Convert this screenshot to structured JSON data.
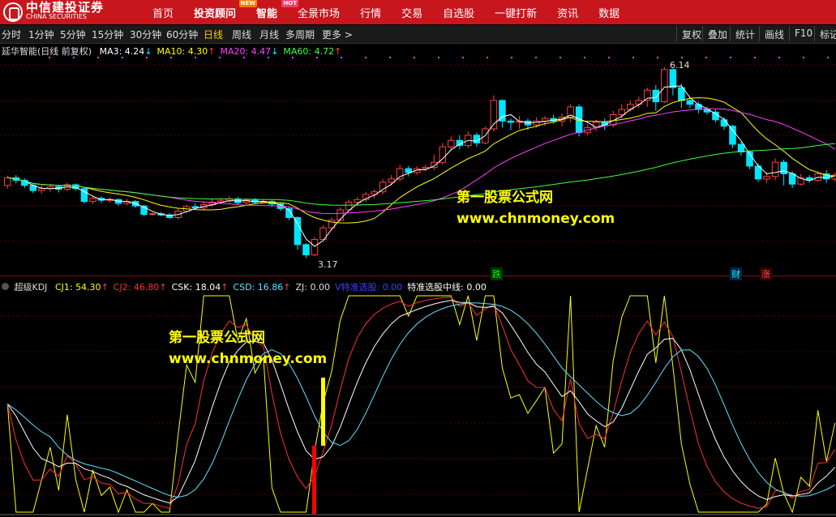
{
  "topbar": {
    "logo_cn": "中信建投证券",
    "logo_en": "CHINA SECURITIES",
    "nav": [
      {
        "label": "首页",
        "badge": ""
      },
      {
        "label": "投资顾问",
        "badge": "NEW",
        "bold": true
      },
      {
        "label": "智能",
        "badge": "HOT",
        "bold": true
      },
      {
        "label": "全景市场",
        "badge": ""
      },
      {
        "label": "行情",
        "badge": ""
      },
      {
        "label": "交易",
        "badge": ""
      },
      {
        "label": "自选股",
        "badge": ""
      },
      {
        "label": "一键打新",
        "badge": ""
      },
      {
        "label": "资讯",
        "badge": ""
      },
      {
        "label": "数据",
        "badge": ""
      }
    ]
  },
  "toolbar": {
    "periods": [
      "分时",
      "1分钟",
      "5分钟",
      "15分钟",
      "30分钟",
      "60分钟",
      "日线",
      "周线",
      "月线",
      "多周期",
      "更多 >"
    ],
    "active_period": "日线",
    "right_buttons": [
      "复权",
      "叠加",
      "统计",
      "画线",
      "F10",
      "标记"
    ]
  },
  "main_panel": {
    "title": "延华智能(日线 前复权)",
    "indicators": [
      {
        "label": "MA3: 4.24",
        "arrow": "↓",
        "color": "#ffffff"
      },
      {
        "label": "MA10: 4.30",
        "arrow": "↑",
        "color": "#ffff00"
      },
      {
        "label": "MA20: 4.47",
        "arrow": "↓",
        "color": "#ff40ff"
      },
      {
        "label": "MA60: 4.72",
        "arrow": "↑",
        "color": "#40ff40"
      }
    ],
    "high_label": "6.14",
    "low_label": "3.17",
    "markers": [
      {
        "text": "跌",
        "color": "#00ff00",
        "bg": "#003300"
      },
      {
        "text": "财",
        "color": "#00ffff",
        "bg": "#002244"
      },
      {
        "text": "涨",
        "color": "#ff5050",
        "bg": "#330000"
      }
    ],
    "watermark_title": "第一股票公式网",
    "watermark_url": "www.chnmoney.com"
  },
  "sub_panel": {
    "title": "超级KDJ",
    "indicators": [
      {
        "label": "CJ1: 54.30",
        "arrow": "↑",
        "color": "#ffff00"
      },
      {
        "label": "CJ2: 46.80",
        "arrow": "↑",
        "color": "#ff3030"
      },
      {
        "label": "CSK: 18.04",
        "arrow": "↑",
        "color": "#ffffff"
      },
      {
        "label": "CSD: 16.86",
        "arrow": "↑",
        "color": "#60e0ff"
      },
      {
        "label": "ZJ: 0.00",
        "arrow": "",
        "color": "#dddddd"
      },
      {
        "label": "V特准选股: 0.00",
        "arrow": "",
        "color": "#4040ff"
      },
      {
        "label": "特准选股中线: 0.00",
        "arrow": "",
        "color": "#ffffff"
      }
    ],
    "watermark_title": "第一股票公式网",
    "watermark_url": "www.chnmoney.com"
  },
  "colors": {
    "up": "#ff4040",
    "down": "#00e5ff",
    "topbar": "#c8161d"
  },
  "chart_data": {
    "type": "candlestick",
    "title": "延华智能(日线 前复权)",
    "ylim": [
      3.0,
      6.3
    ],
    "candles": [
      [
        4.3,
        4.42,
        4.25,
        4.45
      ],
      [
        4.42,
        4.38,
        4.33,
        4.46
      ],
      [
        4.38,
        4.3,
        4.26,
        4.41
      ],
      [
        4.3,
        4.22,
        4.18,
        4.33
      ],
      [
        4.22,
        4.25,
        4.17,
        4.3
      ],
      [
        4.25,
        4.28,
        4.2,
        4.32
      ],
      [
        4.28,
        4.24,
        4.19,
        4.31
      ],
      [
        4.24,
        4.31,
        4.21,
        4.34
      ],
      [
        4.31,
        4.25,
        4.22,
        4.33
      ],
      [
        4.25,
        4.05,
        4.02,
        4.27
      ],
      [
        4.05,
        4.1,
        4.01,
        4.14
      ],
      [
        4.1,
        4.07,
        4.03,
        4.13
      ],
      [
        4.07,
        4.08,
        4.03,
        4.11
      ],
      [
        4.08,
        4.02,
        3.98,
        4.1
      ],
      [
        4.02,
        4.05,
        3.99,
        4.09
      ],
      [
        4.05,
        3.98,
        3.95,
        4.07
      ],
      [
        3.98,
        3.85,
        3.82,
        4.0
      ],
      [
        3.85,
        3.86,
        3.83,
        3.88
      ],
      [
        3.86,
        3.84,
        3.82,
        3.89
      ],
      [
        3.84,
        3.8,
        3.78,
        3.87
      ],
      [
        3.8,
        3.9,
        3.77,
        3.95
      ],
      [
        3.9,
        3.97,
        3.88,
        4.0
      ],
      [
        3.97,
        3.95,
        3.93,
        4.02
      ],
      [
        3.95,
        4.0,
        3.92,
        4.05
      ],
      [
        4.0,
        4.04,
        3.97,
        4.09
      ],
      [
        4.04,
        4.06,
        4.01,
        4.1
      ],
      [
        4.06,
        4.09,
        4.03,
        4.13
      ],
      [
        4.09,
        4.03,
        4.0,
        4.12
      ],
      [
        4.03,
        4.07,
        4.0,
        4.1
      ],
      [
        4.07,
        4.04,
        4.01,
        4.1
      ],
      [
        4.04,
        4.05,
        4.02,
        4.08
      ],
      [
        4.05,
        4.01,
        3.97,
        4.07
      ],
      [
        4.01,
        3.94,
        3.9,
        4.03
      ],
      [
        3.94,
        3.8,
        3.76,
        3.96
      ],
      [
        3.8,
        3.38,
        3.3,
        3.82
      ],
      [
        3.38,
        3.22,
        3.17,
        3.4
      ],
      [
        3.22,
        3.46,
        3.2,
        3.5
      ],
      [
        3.46,
        3.64,
        3.44,
        3.68
      ],
      [
        3.64,
        3.76,
        3.6,
        3.8
      ],
      [
        3.76,
        3.92,
        3.74,
        3.96
      ],
      [
        3.92,
        4.04,
        3.9,
        4.08
      ],
      [
        4.04,
        4.08,
        3.98,
        4.12
      ],
      [
        4.08,
        4.16,
        4.04,
        4.2
      ],
      [
        4.16,
        4.2,
        4.1,
        4.24
      ],
      [
        4.2,
        4.35,
        4.16,
        4.4
      ],
      [
        4.35,
        4.4,
        4.3,
        4.46
      ],
      [
        4.4,
        4.56,
        4.36,
        4.62
      ],
      [
        4.56,
        4.5,
        4.44,
        4.6
      ],
      [
        4.5,
        4.56,
        4.46,
        4.6
      ],
      [
        4.56,
        4.58,
        4.52,
        4.62
      ],
      [
        4.58,
        4.66,
        4.54,
        4.78
      ],
      [
        4.66,
        4.9,
        4.62,
        4.96
      ],
      [
        4.9,
        5.0,
        4.84,
        5.06
      ],
      [
        5.0,
        4.92,
        4.86,
        5.08
      ],
      [
        4.92,
        5.08,
        4.88,
        5.14
      ],
      [
        5.08,
        4.96,
        4.9,
        5.12
      ],
      [
        4.96,
        5.18,
        4.94,
        5.22
      ],
      [
        5.18,
        5.62,
        5.14,
        5.7
      ],
      [
        5.62,
        5.3,
        5.2,
        5.64
      ],
      [
        5.3,
        5.28,
        5.16,
        5.34
      ],
      [
        5.28,
        5.3,
        5.18,
        5.38
      ],
      [
        5.3,
        5.24,
        5.16,
        5.34
      ],
      [
        5.24,
        5.3,
        5.2,
        5.36
      ],
      [
        5.3,
        5.34,
        5.22,
        5.38
      ],
      [
        5.34,
        5.3,
        5.26,
        5.4
      ],
      [
        5.3,
        5.36,
        5.22,
        5.42
      ],
      [
        5.36,
        5.52,
        5.28,
        5.56
      ],
      [
        5.52,
        5.12,
        5.06,
        5.56
      ],
      [
        5.12,
        5.2,
        5.08,
        5.26
      ],
      [
        5.2,
        5.28,
        5.14,
        5.32
      ],
      [
        5.28,
        5.24,
        5.16,
        5.34
      ],
      [
        5.24,
        5.4,
        5.2,
        5.46
      ],
      [
        5.4,
        5.48,
        5.34,
        5.56
      ],
      [
        5.48,
        5.56,
        5.44,
        5.62
      ],
      [
        5.56,
        5.62,
        5.5,
        5.68
      ],
      [
        5.62,
        5.78,
        5.52,
        5.82
      ],
      [
        5.78,
        5.6,
        5.46,
        5.86
      ],
      [
        5.6,
        6.1,
        5.58,
        6.14
      ],
      [
        6.1,
        5.82,
        5.7,
        6.12
      ],
      [
        5.82,
        5.62,
        5.5,
        5.88
      ],
      [
        5.62,
        5.56,
        5.5,
        5.66
      ],
      [
        5.56,
        5.48,
        5.42,
        5.6
      ],
      [
        5.48,
        5.44,
        5.4,
        5.52
      ],
      [
        5.44,
        5.32,
        5.28,
        5.48
      ],
      [
        5.32,
        5.22,
        5.16,
        5.36
      ],
      [
        5.22,
        4.94,
        4.88,
        5.24
      ],
      [
        4.94,
        4.82,
        4.76,
        4.98
      ],
      [
        4.82,
        4.6,
        4.55,
        4.85
      ],
      [
        4.6,
        4.4,
        4.36,
        4.64
      ],
      [
        4.4,
        4.44,
        4.34,
        4.5
      ],
      [
        4.44,
        4.66,
        4.38,
        4.72
      ],
      [
        4.66,
        4.48,
        4.3,
        4.7
      ],
      [
        4.48,
        4.32,
        4.26,
        4.52
      ],
      [
        4.32,
        4.42,
        4.3,
        4.48
      ],
      [
        4.42,
        4.38,
        4.34,
        4.46
      ],
      [
        4.38,
        4.48,
        4.36,
        4.52
      ],
      [
        4.48,
        4.4,
        4.34,
        4.54
      ],
      [
        4.4,
        4.46,
        4.36,
        4.5
      ]
    ],
    "high": 6.14,
    "low": 3.17
  }
}
